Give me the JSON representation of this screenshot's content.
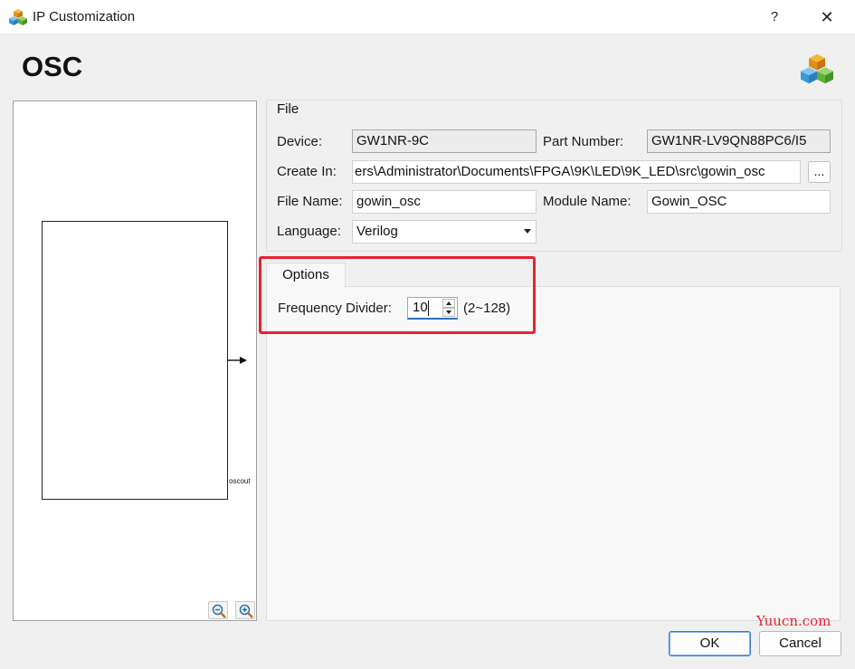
{
  "window": {
    "title": "IP Customization",
    "help": "?",
    "close": "✕"
  },
  "header": {
    "title": "OSC"
  },
  "preview": {
    "port_label": "oscout"
  },
  "file_group": {
    "title": "File",
    "device_label": "Device:",
    "device_value": "GW1NR-9C",
    "part_number_label": "Part Number:",
    "part_number_value": "GW1NR-LV9QN88PC6/I5",
    "create_in_label": "Create In:",
    "create_in_value": "ers\\Administrator\\Documents\\FPGA\\9K\\LED\\9K_LED\\src\\gowin_osc",
    "browse_label": "...",
    "file_name_label": "File Name:",
    "file_name_value": "gowin_osc",
    "module_name_label": "Module Name:",
    "module_name_value": "Gowin_OSC",
    "language_label": "Language:",
    "language_value": "Verilog"
  },
  "options": {
    "tab_label": "Options",
    "freq_divider_label": "Frequency Divider:",
    "freq_divider_value": "10",
    "freq_divider_range": "(2~128)"
  },
  "buttons": {
    "ok": "OK",
    "cancel": "Cancel"
  },
  "watermark": "Yuucn.com",
  "colors": {
    "highlight": "#e8232f",
    "focus": "#2f6fb8"
  }
}
